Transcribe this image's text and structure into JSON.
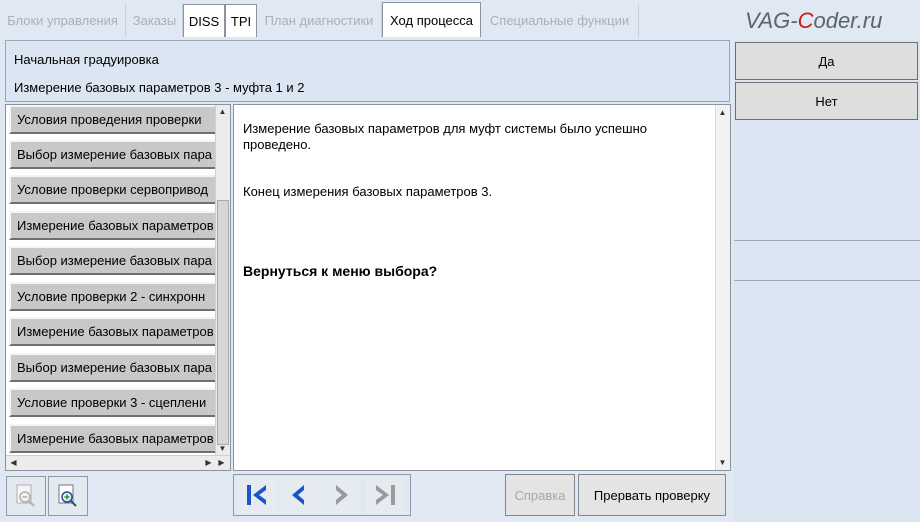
{
  "tabs": [
    {
      "label": "Блоки управления",
      "enabled": false
    },
    {
      "label": "Заказы",
      "enabled": false
    },
    {
      "label": "DISS",
      "enabled": true
    },
    {
      "label": "TPI",
      "enabled": true
    },
    {
      "label": "План диагностики",
      "enabled": false
    },
    {
      "label": "Ход процесса",
      "enabled": true,
      "active": true
    },
    {
      "label": "Специальные функции",
      "enabled": false
    }
  ],
  "watermark": {
    "part1": "VAG-",
    "part2": "C",
    "part3": "oder.ru"
  },
  "header": {
    "title": "Начальная градуировка",
    "subtitle": "Измерение базовых параметров 3 - муфта 1 и 2"
  },
  "steps": [
    "Условия проведения проверки",
    "Выбор измерение базовых пара",
    "Условие проверки сервопривод",
    "Измерение базовых параметров",
    "Выбор измерение базовых пара",
    "Условие проверки 2 - синхронн",
    "Измерение базовых параметров",
    "Выбор измерение базовых пара",
    "Условие проверки 3 - сцеплени",
    "Измерение базовых параметров"
  ],
  "message": {
    "p1": "Измерение базовых параметров для муфт системы было успешно проведено.",
    "p2": "Конец измерения базовых параметров 3.",
    "question": "Вернуться к меню выбора?"
  },
  "answers": {
    "yes": "Да",
    "no": "Нет"
  },
  "bottom": {
    "help_label": "Справка",
    "abort_label": "Прервать проверку"
  },
  "colors": {
    "nav_icon": "#1a55c8",
    "nav_icon_disabled": "#9a9a9a",
    "watermark_accent": "#d31818"
  }
}
